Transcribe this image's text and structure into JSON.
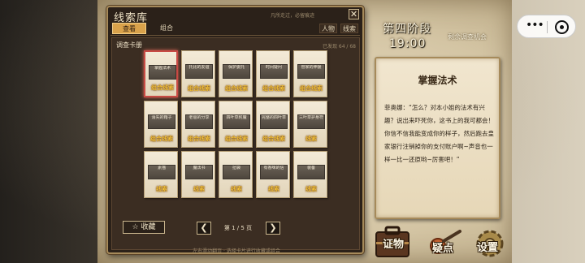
{
  "panel": {
    "title": "线索库",
    "hint": "凡所走过，必留痕迹",
    "close_glyph": "✕",
    "tabs": [
      {
        "label": "查看"
      },
      {
        "label": "组合"
      }
    ],
    "filters": {
      "people": "人物",
      "clues": "线索"
    },
    "section_title": "调查卡册",
    "count": "已发现 64 / 68",
    "cards": [
      {
        "label": "掌握法术",
        "badge": "组合线索",
        "selected": true
      },
      {
        "label": "托比的友谊",
        "badge": "组合线索"
      },
      {
        "label": "保护委托",
        "badge": "组合线索"
      },
      {
        "label": "时间疑问",
        "badge": "组合线索"
      },
      {
        "label": "管家的伸援",
        "badge": "组合线索"
      },
      {
        "label": "消失的箱子",
        "badge": "组合线索"
      },
      {
        "label": "老爸的分享",
        "badge": "组合线索"
      },
      {
        "label": "四叶草附魔",
        "badge": "组合线索"
      },
      {
        "label": "完整的四叶草",
        "badge": "组合线索"
      },
      {
        "label": "三叶草护身符",
        "badge": "线索"
      },
      {
        "label": "素描",
        "badge": "线索"
      },
      {
        "label": "魔法书",
        "badge": "线索"
      },
      {
        "label": "扭袋",
        "badge": "线索"
      },
      {
        "label": "有香味的信",
        "badge": "线索"
      },
      {
        "label": "装备",
        "badge": "线索"
      }
    ],
    "favorite_label": "☆ 收藏",
    "prev_glyph": "❮",
    "next_glyph": "❯",
    "page_indicator": "第 1 / 5 页",
    "footer_hint": "左右滑动翻页 · 选择卡片进行收藏或组合"
  },
  "status": {
    "phase": "第四阶段",
    "time": "19:00",
    "remaining": "剩余调查机会"
  },
  "note": {
    "title": "掌握法术",
    "body": "菲奥娜：“怎么？对本小姐的法术有兴趣？说出来吓死你，这书上的我可都会！你信不信我能变成你的样子，然后跑去皇家银行注销掉你的支付账户啊~声音也一样一比一还原哟~厉害吧！”"
  },
  "buttons": {
    "evidence": "证物",
    "clue": "疑点",
    "settings": "设置"
  },
  "capsule": {
    "more_glyph": "•••"
  },
  "colors": {
    "accent": "#d9a24b",
    "badge": "#f2c23a",
    "selected": "#c84a44"
  }
}
